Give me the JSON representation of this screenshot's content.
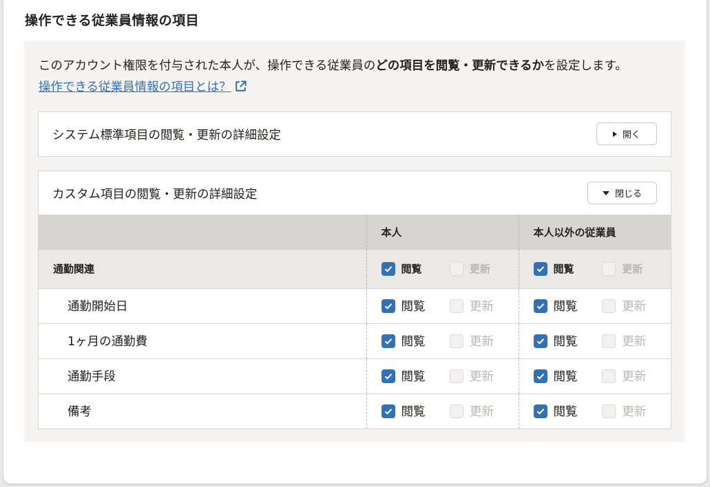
{
  "section_title": "操作できる従業員情報の項目",
  "description": {
    "before": "このアカウント権限を付与された本人が、操作できる従業員の",
    "bold": "どの項目を閲覧・更新できるか",
    "after": "を設定します。"
  },
  "help_link": "操作できる従業員情報の項目とは？",
  "standard_section": {
    "title": "システム標準項目の閲覧・更新の詳細設定",
    "button": "開く"
  },
  "custom_section": {
    "title": "カスタム項目の閲覧・更新の詳細設定",
    "button": "閉じる",
    "columns": [
      "",
      "本人",
      "本人以外の従業員"
    ],
    "view_label": "閲覧",
    "update_label": "更新",
    "group": {
      "label": "通勤関連",
      "self_view": true,
      "self_update": false,
      "others_view": true,
      "others_update": false
    },
    "rows": [
      {
        "label": "通勤開始日",
        "self_view": true,
        "self_update": false,
        "others_view": true,
        "others_update": false
      },
      {
        "label": "1ヶ月の通勤費",
        "self_view": true,
        "self_update": false,
        "others_view": true,
        "others_update": false
      },
      {
        "label": "通勤手段",
        "self_view": true,
        "self_update": false,
        "others_view": true,
        "others_update": false
      },
      {
        "label": "備考",
        "self_view": true,
        "self_update": false,
        "others_view": true,
        "others_update": false
      }
    ]
  },
  "colors": {
    "accent": "#3470b5",
    "header_bg": "#d6d5d1",
    "panel_bg": "#f5f4f2"
  }
}
